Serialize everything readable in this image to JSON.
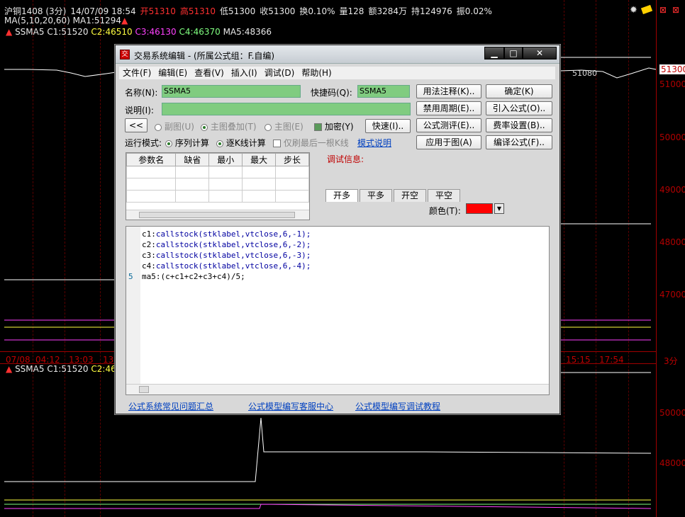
{
  "chart": {
    "info": {
      "symbol": "沪铜1408 (3分)",
      "datetime": "14/07/09 18:54",
      "open": "开51310",
      "high": "高51310",
      "low": "低51300",
      "close": "收51300",
      "turnover_rate": "换0.10%",
      "volume": "量128",
      "amount": "额3284万",
      "position": "持124976",
      "amplitude": "振0.02%"
    },
    "ma_legend": {
      "name": "MA(5,10,20,60)",
      "ma1": "MA1:51294"
    },
    "ssma_legend": {
      "name": "SSMA5",
      "c1": "C1:51520",
      "c2": "C2:46510",
      "c3": "C3:46130",
      "c4": "C4:46370",
      "ma5": "MA5:48366"
    },
    "ssma_legend2": {
      "name": "SSMA5",
      "c1": "C1:51520",
      "c2": "C2:46"
    },
    "price_labels": [
      "51300",
      "51000",
      "50000",
      "49000",
      "48000",
      "47000",
      "50000",
      "48000"
    ],
    "inline_price": "51080",
    "time_labels": [
      "07/08",
      "04:12",
      "13:03",
      "13",
      "15:15",
      "17:54"
    ],
    "period_label": "3分"
  },
  "dialog": {
    "title": "交易系统编辑 - (所属公式组：F.自编)",
    "menu": [
      "文件(F)",
      "编辑(E)",
      "查看(V)",
      "插入(I)",
      "调试(D)",
      "帮助(H)"
    ],
    "name_label": "名称(N):",
    "name_value": "SSMA5",
    "shortcut_label": "快捷码(Q):",
    "shortcut_value": "SSMA5",
    "desc_label": "说明(I):",
    "desc_value": "",
    "buttons": {
      "usage_note": "用法注释(K)..",
      "confirm": "确定(K)",
      "disable_period": "禁用周期(E)..",
      "import_formula": "引入公式(O)..",
      "formula_test": "公式测评(E)..",
      "fee_settings": "费率设置(B)..",
      "apply_chart": "应用于图(A)",
      "compile_formula": "编译公式(F)..",
      "collapse": "<<",
      "quick": "快速(I).."
    },
    "options": {
      "sub_chart": "副图(U)",
      "main_overlay": "主图叠加(T)",
      "main_chart": "主图(E)",
      "encrypt": "加密(Y)"
    },
    "run_mode_label": "运行模式:",
    "run_modes": {
      "sequential": "序列计算",
      "bar_by_bar": "逐K线计算"
    },
    "refresh_last": "仅刷最后一根K线",
    "mode_link": "模式说明",
    "param_headers": [
      "参数名",
      "缺省",
      "最小",
      "最大",
      "步长"
    ],
    "debug_label": "调试信息:",
    "tabs": [
      "开多",
      "平多",
      "开空",
      "平空"
    ],
    "color_label": "颜色(T):",
    "color_value": "#ff0000",
    "code_lines": [
      {
        "num": "",
        "prefix": "c1:",
        "fn": "callstock",
        "args": "(stklabel,vtclose,6,-1);"
      },
      {
        "num": "",
        "prefix": "c2:",
        "fn": "callstock",
        "args": "(stklabel,vtclose,6,-2);"
      },
      {
        "num": "",
        "prefix": "c3:",
        "fn": "callstock",
        "args": "(stklabel,vtclose,6,-3);"
      },
      {
        "num": "",
        "prefix": "c4:",
        "fn": "callstock",
        "args": "(stklabel,vtclose,6,-4);"
      },
      {
        "num": "5",
        "prefix": "ma5:(c+c1+c2+c3+c4)/5;",
        "fn": "",
        "args": ""
      }
    ],
    "links": [
      "公式系统常见问题汇总",
      "公式模型编写客服中心",
      "公式模型编写调试教程"
    ]
  }
}
